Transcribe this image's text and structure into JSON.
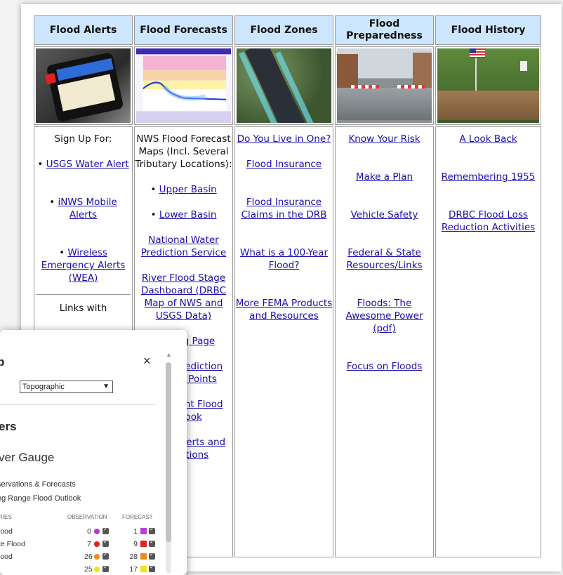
{
  "headers": [
    "Flood Alerts",
    "Flood Forecasts",
    "Flood Zones",
    "Flood Preparedness",
    "Flood History"
  ],
  "images": {
    "alerts": "phone-severe-alert-image",
    "forecasts": "hydrograph-chart-image",
    "zones": "aerial-flood-zone-map-image",
    "preparedness": "flooded-street-barricade-image",
    "history": "flooded-house-flag-image"
  },
  "col1": {
    "sign_up": "Sign Up For:",
    "items": [
      "USGS Water Alert",
      "iNWS Mobile Alerts",
      "Wireless Emergency Alerts (WEA)"
    ],
    "links_with": "Links with"
  },
  "col2": {
    "intro": "NWS Flood Forecast Maps (Incl. Several Tributary Locations):",
    "items": [
      "Upper Basin",
      "Lower Basin"
    ],
    "links": [
      "National Water Prediction Service",
      "River Flood Stage Dashboard (DRBC Map of NWS and USGS Data)",
      "Briefing Page",
      "Water Prediction Service Points",
      "Significant Flood Outlook",
      "Marine Alerts and Conditions"
    ]
  },
  "col3": {
    "links": [
      "Do You Live in One?",
      "Flood Insurance",
      "Flood Insurance Claims in the DRB",
      "What is a 100-Year Flood?",
      "More FEMA Products and Resources"
    ]
  },
  "col4": {
    "links": [
      "Know Your Risk",
      "Make a Plan",
      "Vehicle Safety",
      "Federal & State Resources/Links",
      "Floods: The Awesome Power (pdf)",
      "Focus on Floods"
    ]
  },
  "col5": {
    "links": [
      "A Look Back",
      "Remembering 1955",
      "DRBC Flood Loss Reduction Activities"
    ]
  },
  "panel": {
    "title_fragment": "p",
    "close": "×",
    "basemap": "Topographic",
    "layers_title": "ers",
    "gauge_title": "ver Gauge",
    "obs_forecasts": "servations & Forecasts",
    "long_range": "ng Range Flood Outlook",
    "col_series": "RIES",
    "col_observation": "OBSERVATION",
    "col_forecast": "FORECAST",
    "rows": [
      {
        "label": "lood",
        "obs": "0",
        "obs_color": "#b23ad6",
        "fc": "1",
        "fc_color": "#c13bd9"
      },
      {
        "label": "te Flood",
        "obs": "7",
        "obs_color": "#e02323",
        "fc": "9",
        "fc_color": "#e02323"
      },
      {
        "label": "lood",
        "obs": "26",
        "obs_color": "#f08a1a",
        "fc": "28",
        "fc_color": "#f08a1a"
      },
      {
        "label": "",
        "obs": "25",
        "obs_color": "#f2e224",
        "fc": "17",
        "fc_color": "#f2e224"
      }
    ]
  }
}
